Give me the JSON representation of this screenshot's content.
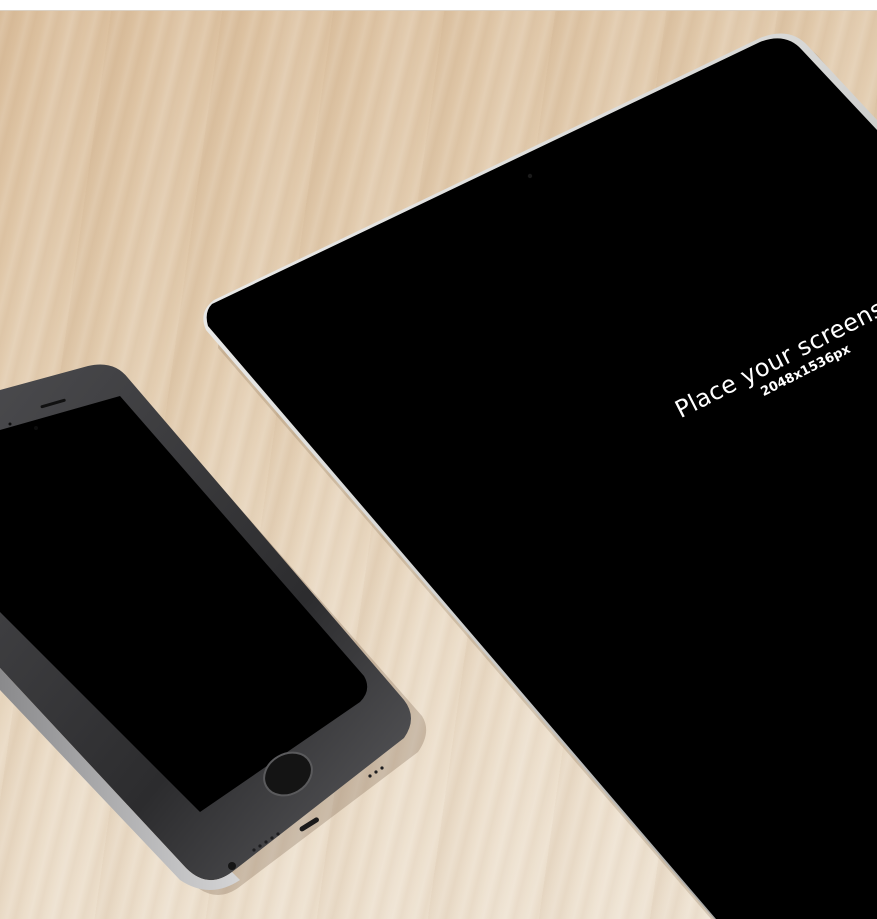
{
  "tablet_screen": {
    "title": "Place your screensh",
    "dimensions": "2048x1536px"
  },
  "colors": {
    "desk": "#e3cdb0",
    "screen": "#000000",
    "tablet_frame": "#d8d8d6",
    "phone_body": "#2a2a2c",
    "caption_text": "#ffffff"
  }
}
